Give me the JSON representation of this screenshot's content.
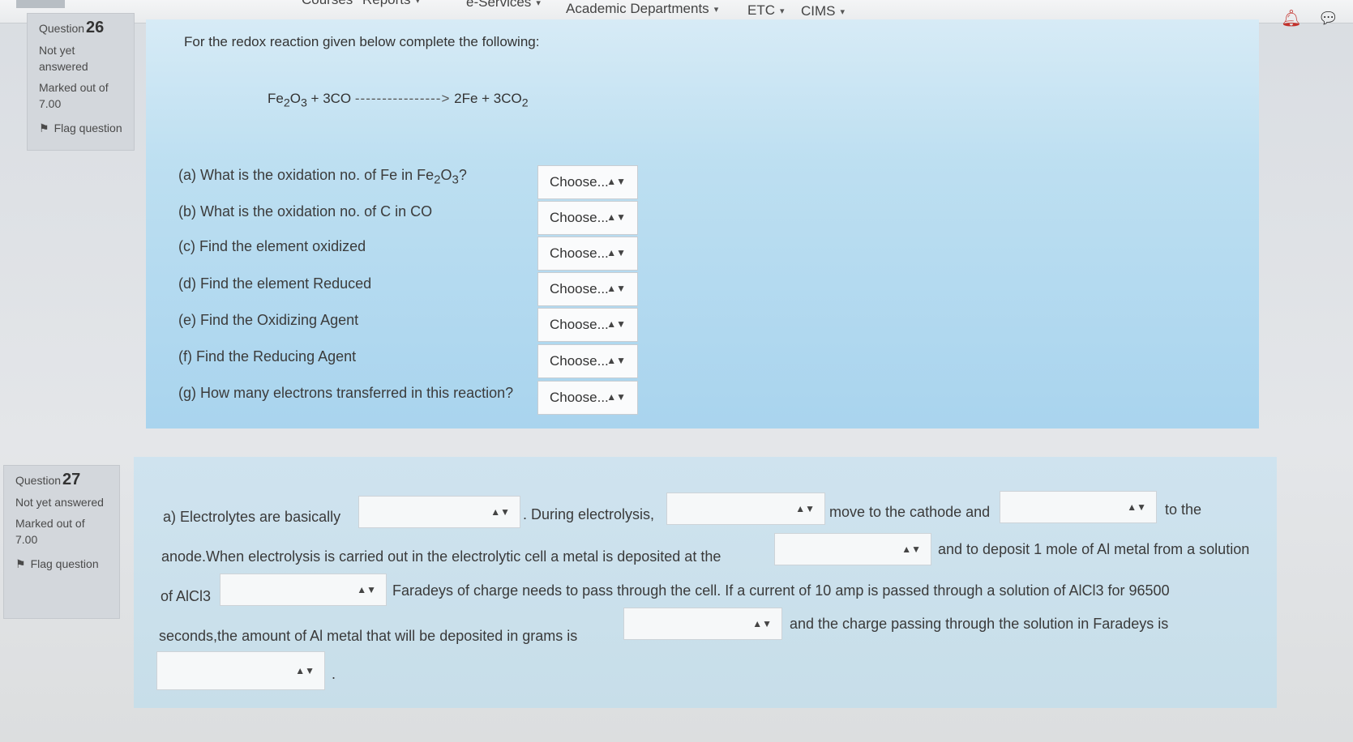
{
  "nav": {
    "items": [
      {
        "label": "Courses",
        "caret": false
      },
      {
        "label": "Reports",
        "caret": true
      },
      {
        "label": "e-Services",
        "caret": true
      },
      {
        "label": "Academic Departments",
        "caret": true
      },
      {
        "label": "ETC",
        "caret": true
      },
      {
        "label": "CIMS",
        "caret": true
      }
    ]
  },
  "q26": {
    "question_label": "Question",
    "question_number": "26",
    "state": "Not yet answered",
    "marked_label": "Marked out of",
    "marked_value": "7.00",
    "flag_label": "Flag question",
    "prompt": "For the redox reaction given below complete the following:",
    "equation": {
      "lhs_prefix": "Fe",
      "lhs_sub1": "2",
      "lhs_mid": "O",
      "lhs_sub2": "3",
      "lhs_suffix": " + 3CO ",
      "arrow": "---------------->",
      "rhs_prefix": " 2Fe + 3CO",
      "rhs_sub": "2"
    },
    "subquestions": [
      {
        "label": "(a) What is the oxidation no. of Fe in Fe",
        "sub1": "2",
        "mid": "O",
        "sub2": "3",
        "tail": "?",
        "select": "Choose..."
      },
      {
        "label": "(b) What is the oxidation no. of C in CO",
        "select": "Choose..."
      },
      {
        "label": "(c) Find the element oxidized",
        "select": "Choose..."
      },
      {
        "label": "(d) Find the element Reduced",
        "select": "Choose..."
      },
      {
        "label": "(e) Find the Oxidizing Agent",
        "select": "Choose..."
      },
      {
        "label": "(f) Find the Reducing Agent",
        "select": "Choose..."
      },
      {
        "label": "(g) How many electrons transferred in this reaction?",
        "select": "Choose..."
      }
    ]
  },
  "q27": {
    "question_label": "Question",
    "question_number": "27",
    "state": "Not yet answered",
    "marked_label": "Marked out of",
    "marked_value": "7.00",
    "flag_label": "Flag question",
    "text": {
      "t1": "a) Electrolytes are basically",
      "t2": ". During electrolysis,",
      "t3": "move to the cathode and",
      "t4": "to the",
      "t5": "anode.When electrolysis is carried out in the electrolytic cell a metal is deposited at the",
      "t6": "and to deposit 1 mole of Al metal from a solution",
      "t7": "of AlCl3",
      "t8": "Faradeys of charge needs to pass through the cell. If a current of 10 amp is passed through a solution of AlCl3 for 96500",
      "t9": "seconds,the amount of Al metal that will be deposited in grams is",
      "t10": "and the charge passing through the solution in Faradeys is",
      "t11": "."
    }
  }
}
